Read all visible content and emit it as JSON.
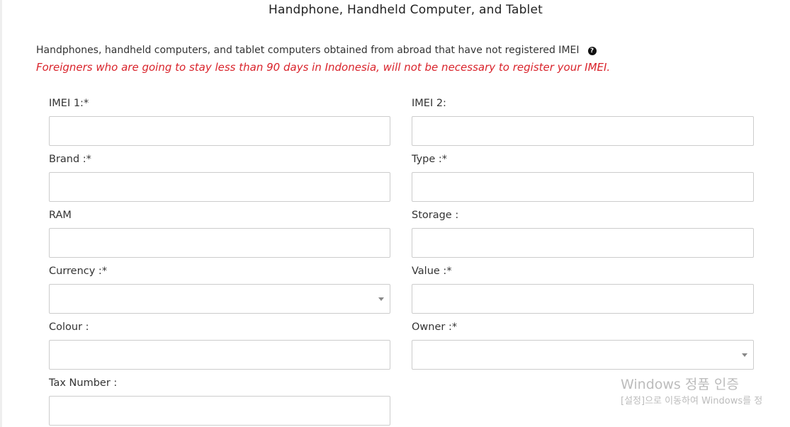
{
  "page": {
    "title": "Handphone, Handheld Computer, and Tablet",
    "info_text": "Handphones, handheld computers, and tablet computers obtained from abroad that have not registered IMEI",
    "help_icon": "question-circle-icon",
    "note_text": "Foreigners who are going to stay less than 90 days in Indonesia, will not be necessary to register your IMEI.",
    "note_color": "#d9232b"
  },
  "form": {
    "imei1": {
      "label": "IMEI 1:*",
      "value": ""
    },
    "imei2": {
      "label": "IMEI 2:",
      "value": ""
    },
    "brand": {
      "label": "Brand :*",
      "value": ""
    },
    "type": {
      "label": "Type :*",
      "value": ""
    },
    "ram": {
      "label": "RAM",
      "value": ""
    },
    "storage": {
      "label": "Storage :",
      "value": ""
    },
    "currency": {
      "label": "Currency :*",
      "value": ""
    },
    "value": {
      "label": "Value :*",
      "value": ""
    },
    "colour": {
      "label": "Colour :",
      "value": ""
    },
    "owner": {
      "label": "Owner :*",
      "value": ""
    },
    "tax_number": {
      "label": "Tax Number :",
      "value": ""
    }
  },
  "watermark": {
    "line1": "Windows 정품 인증",
    "line2": "[설정]으로 이동하여 Windows를 정"
  }
}
